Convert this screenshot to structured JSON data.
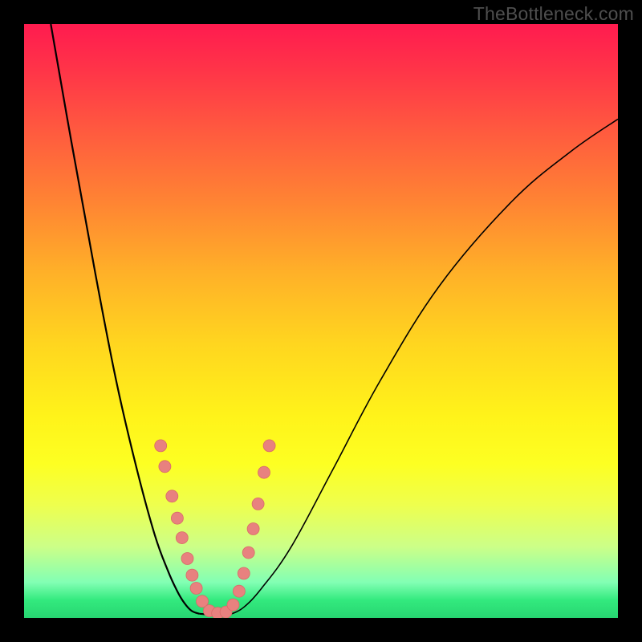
{
  "watermark": "TheBottleneck.com",
  "chart_data": {
    "type": "line",
    "title": "",
    "xlabel": "",
    "ylabel": "",
    "xlim": [
      0,
      1
    ],
    "ylim": [
      0,
      1
    ],
    "note": "V-shaped bottleneck curve over a vertical red→green gradient. Axes are unlabeled; values below are normalized estimates read from the plot area.",
    "series": [
      {
        "name": "left-branch",
        "x": [
          0.045,
          0.08,
          0.12,
          0.155,
          0.19,
          0.22,
          0.242,
          0.258,
          0.27,
          0.282,
          0.295
        ],
        "y": [
          1.0,
          0.8,
          0.58,
          0.4,
          0.25,
          0.14,
          0.08,
          0.045,
          0.025,
          0.012,
          0.007
        ]
      },
      {
        "name": "valley",
        "x": [
          0.295,
          0.31,
          0.33,
          0.35
        ],
        "y": [
          0.007,
          0.006,
          0.006,
          0.007
        ]
      },
      {
        "name": "right-branch",
        "x": [
          0.35,
          0.37,
          0.4,
          0.45,
          0.52,
          0.6,
          0.7,
          0.82,
          0.92,
          1.0
        ],
        "y": [
          0.007,
          0.018,
          0.05,
          0.12,
          0.25,
          0.4,
          0.56,
          0.7,
          0.785,
          0.84
        ]
      }
    ],
    "beads": {
      "description": "Pink dotted markers clustered near the valley on both branches",
      "points": [
        {
          "x": 0.23,
          "y": 0.29
        },
        {
          "x": 0.237,
          "y": 0.255
        },
        {
          "x": 0.249,
          "y": 0.205
        },
        {
          "x": 0.258,
          "y": 0.168
        },
        {
          "x": 0.266,
          "y": 0.135
        },
        {
          "x": 0.275,
          "y": 0.1
        },
        {
          "x": 0.283,
          "y": 0.072
        },
        {
          "x": 0.29,
          "y": 0.05
        },
        {
          "x": 0.3,
          "y": 0.028
        },
        {
          "x": 0.312,
          "y": 0.012
        },
        {
          "x": 0.326,
          "y": 0.008
        },
        {
          "x": 0.34,
          "y": 0.01
        },
        {
          "x": 0.352,
          "y": 0.022
        },
        {
          "x": 0.362,
          "y": 0.045
        },
        {
          "x": 0.37,
          "y": 0.075
        },
        {
          "x": 0.378,
          "y": 0.11
        },
        {
          "x": 0.386,
          "y": 0.15
        },
        {
          "x": 0.394,
          "y": 0.192
        },
        {
          "x": 0.404,
          "y": 0.245
        },
        {
          "x": 0.413,
          "y": 0.29
        }
      ]
    },
    "gradient_stops": [
      {
        "pos": 0.0,
        "color": "#ff1b4f"
      },
      {
        "pos": 0.5,
        "color": "#ffe81c"
      },
      {
        "pos": 1.0,
        "color": "#27d571"
      }
    ]
  }
}
